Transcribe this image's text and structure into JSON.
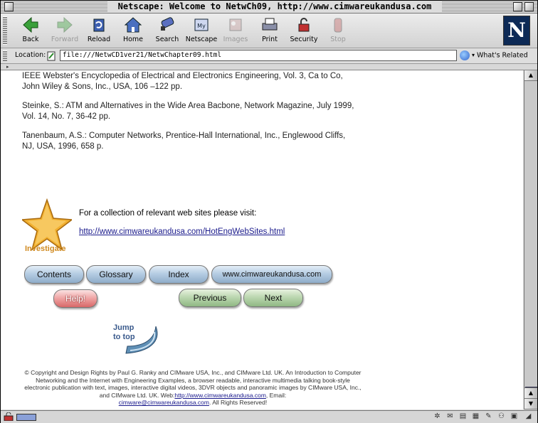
{
  "window": {
    "title": "Netscape: Welcome to NetwCh09, http://www.cimwareukandusa.com"
  },
  "toolbar": {
    "buttons": [
      {
        "label": "Back",
        "icon": "back-arrow-icon",
        "enabled": true
      },
      {
        "label": "Forward",
        "icon": "forward-arrow-icon",
        "enabled": false
      },
      {
        "label": "Reload",
        "icon": "reload-icon",
        "enabled": true
      },
      {
        "label": "Home",
        "icon": "home-icon",
        "enabled": true
      },
      {
        "label": "Search",
        "icon": "search-icon",
        "enabled": true
      },
      {
        "label": "Netscape",
        "icon": "netscape-my-icon",
        "enabled": true
      },
      {
        "label": "Images",
        "icon": "images-icon",
        "enabled": false
      },
      {
        "label": "Print",
        "icon": "print-icon",
        "enabled": true
      },
      {
        "label": "Security",
        "icon": "security-lock-icon",
        "enabled": true
      },
      {
        "label": "Stop",
        "icon": "stop-icon",
        "enabled": false
      }
    ],
    "logo_letter": "N"
  },
  "location": {
    "label": "Location:",
    "url": "file:///NetwCD1ver21/NetwChapter09.html",
    "related_label": "What's Related"
  },
  "content": {
    "references": [
      "IEEE Webster's Encyclopedia of Electrical and Electronics Engineering, Vol. 3, Ca to Co, John Wiley & Sons, Inc., USA, 106 –122 pp.",
      "Steinke, S.: ATM and Alternatives in the Wide Area Bacbone, Network Magazine, July 1999, Vol. 14, No. 7, 36-42 pp.",
      "Tanenbaum, A.S.: Computer Networks, Prentice-Hall International, Inc., Englewood Cliffs, NJ, USA, 1996, 658 p."
    ],
    "investigate_label": "Investigate",
    "collection_text": "For a collection of relevant web sites please visit:",
    "collection_link": "http://www.cimwareukandusa.com/HotEngWebSites.html",
    "nav": {
      "contents": "Contents",
      "glossary": "Glossary",
      "index": "Index",
      "website": "www.cimwareukandusa.com",
      "help": "Help!",
      "previous": "Previous",
      "next": "Next"
    },
    "jump_to_top": [
      "Jump",
      "to top"
    ],
    "copyright_text": "© Copyright and Design Rights by Paul G. Ranky and CIMware USA, Inc., and CIMware Ltd. UK. An Introduction to Computer Networking and the Internet with Engineering Examples, a browser readable, interactive multimedia talking book-style electronic publication with text, images, interactive digital videos, 3DVR objects and panoramic images by CIMware USA, Inc., and CIMware Ltd. UK. Web:",
    "copyright_web": "http://www.cimwareukandusa.com",
    "copyright_email_label": ", Email:",
    "copyright_email": "cimware@cimwareukandusa.com",
    "copyright_end": ". All Rights Reserved!"
  },
  "colors": {
    "link": "#1a1a8c",
    "netscape_logo_bg": "#0d2a56",
    "scroll_thumb": "#6d7ed6"
  }
}
